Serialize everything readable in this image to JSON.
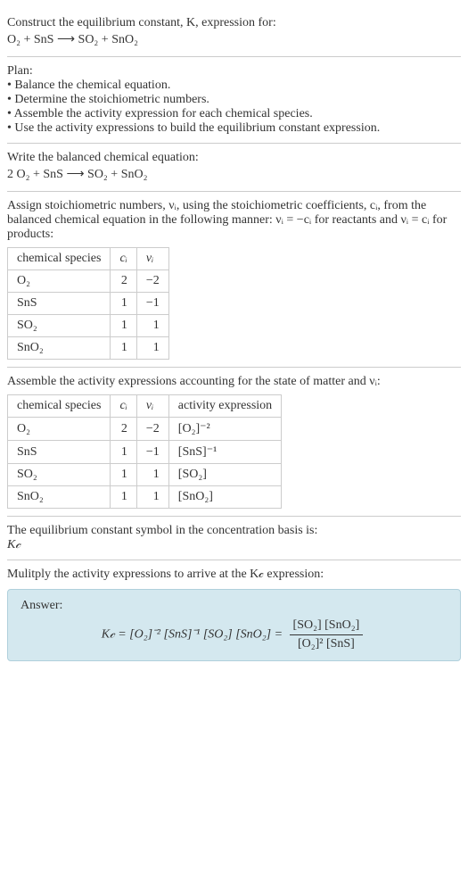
{
  "s1": {
    "intro": "Construct the equilibrium constant, K, expression for:",
    "eq": "O₂ + SnS ⟶ SO₂ + SnO₂"
  },
  "s2": {
    "plan_label": "Plan:",
    "b1": "• Balance the chemical equation.",
    "b2": "• Determine the stoichiometric numbers.",
    "b3": "• Assemble the activity expression for each chemical species.",
    "b4": "• Use the activity expressions to build the equilibrium constant expression."
  },
  "s3": {
    "t1": "Write the balanced chemical equation:",
    "eq": "2 O₂ + SnS ⟶ SO₂ + SnO₂"
  },
  "s4": {
    "t1": "Assign stoichiometric numbers, νᵢ, using the stoichiometric coefficients, cᵢ, from the balanced chemical equation in the following manner: νᵢ = −cᵢ for reactants and νᵢ = cᵢ for products:",
    "h1": "chemical species",
    "h2": "cᵢ",
    "h3": "νᵢ",
    "r1c1": "O₂",
    "r1c2": "2",
    "r1c3": "−2",
    "r2c1": "SnS",
    "r2c2": "1",
    "r2c3": "−1",
    "r3c1": "SO₂",
    "r3c2": "1",
    "r3c3": "1",
    "r4c1": "SnO₂",
    "r4c2": "1",
    "r4c3": "1"
  },
  "s5": {
    "t1": "Assemble the activity expressions accounting for the state of matter and νᵢ:",
    "h1": "chemical species",
    "h2": "cᵢ",
    "h3": "νᵢ",
    "h4": "activity expression",
    "r1c1": "O₂",
    "r1c2": "2",
    "r1c3": "−2",
    "r1c4": "[O₂]⁻²",
    "r2c1": "SnS",
    "r2c2": "1",
    "r2c3": "−1",
    "r2c4": "[SnS]⁻¹",
    "r3c1": "SO₂",
    "r3c2": "1",
    "r3c3": "1",
    "r3c4": "[SO₂]",
    "r4c1": "SnO₂",
    "r4c2": "1",
    "r4c3": "1",
    "r4c4": "[SnO₂]"
  },
  "s6": {
    "t1": "The equilibrium constant symbol in the concentration basis is:",
    "t2": "K𝒸"
  },
  "s7": {
    "t1": "Mulitply the activity expressions to arrive at the K𝒸 expression:"
  },
  "ans": {
    "label": "Answer:",
    "lhs": "K𝒸 = [O₂]⁻² [SnS]⁻¹ [SO₂] [SnO₂] = ",
    "num": "[SO₂] [SnO₂]",
    "den": "[O₂]² [SnS]"
  }
}
